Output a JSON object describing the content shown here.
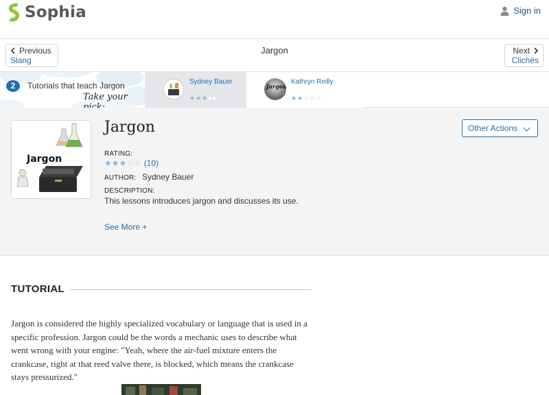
{
  "header": {
    "logo_text": "Sophia",
    "signin_label": "Sign in"
  },
  "nav": {
    "prev_dir": "Previous",
    "prev_target": "Slang",
    "title": "Jargon",
    "next_dir": "Next",
    "next_target": "Clichés"
  },
  "tutorials_strip": {
    "count": "2",
    "label": "Tutorials that teach Jargon",
    "pick_label": "Take your pick:",
    "items": [
      {
        "author": "Sydney Bauer",
        "rating_stars": 3,
        "selected": true
      },
      {
        "author": "Kathryn Reilly",
        "rating_stars": 2.5,
        "selected": false
      }
    ]
  },
  "lesson": {
    "title": "Jargon",
    "other_actions_label": "Other Actions",
    "rating_label": "RATING:",
    "rating_stars": 3,
    "rating_count": "(10)",
    "author_label": "AUTHOR:",
    "author": "Sydney Bauer",
    "description_label": "DESCRIPTION:",
    "description": "This lessons introduces jargon and discusses its use.",
    "see_more_label": "See More +",
    "thumbnail_text": "Jargon"
  },
  "tutorial": {
    "heading": "TUTORIAL",
    "body": "Jargon is considered the highly specialized vocabulary or language that is used in a specific profession. Jargon could be the words a mechanic uses to describe what went wrong with your engine: \"Yeah, where the air-fuel mixture enters the crankcase, right at that reed valve there, is blocked, which means the crankcase stays pressurized.\""
  },
  "colors": {
    "brand_green": "#8cc63f",
    "link_blue": "#1f6fb0",
    "star_blue": "#7fb4e0"
  }
}
